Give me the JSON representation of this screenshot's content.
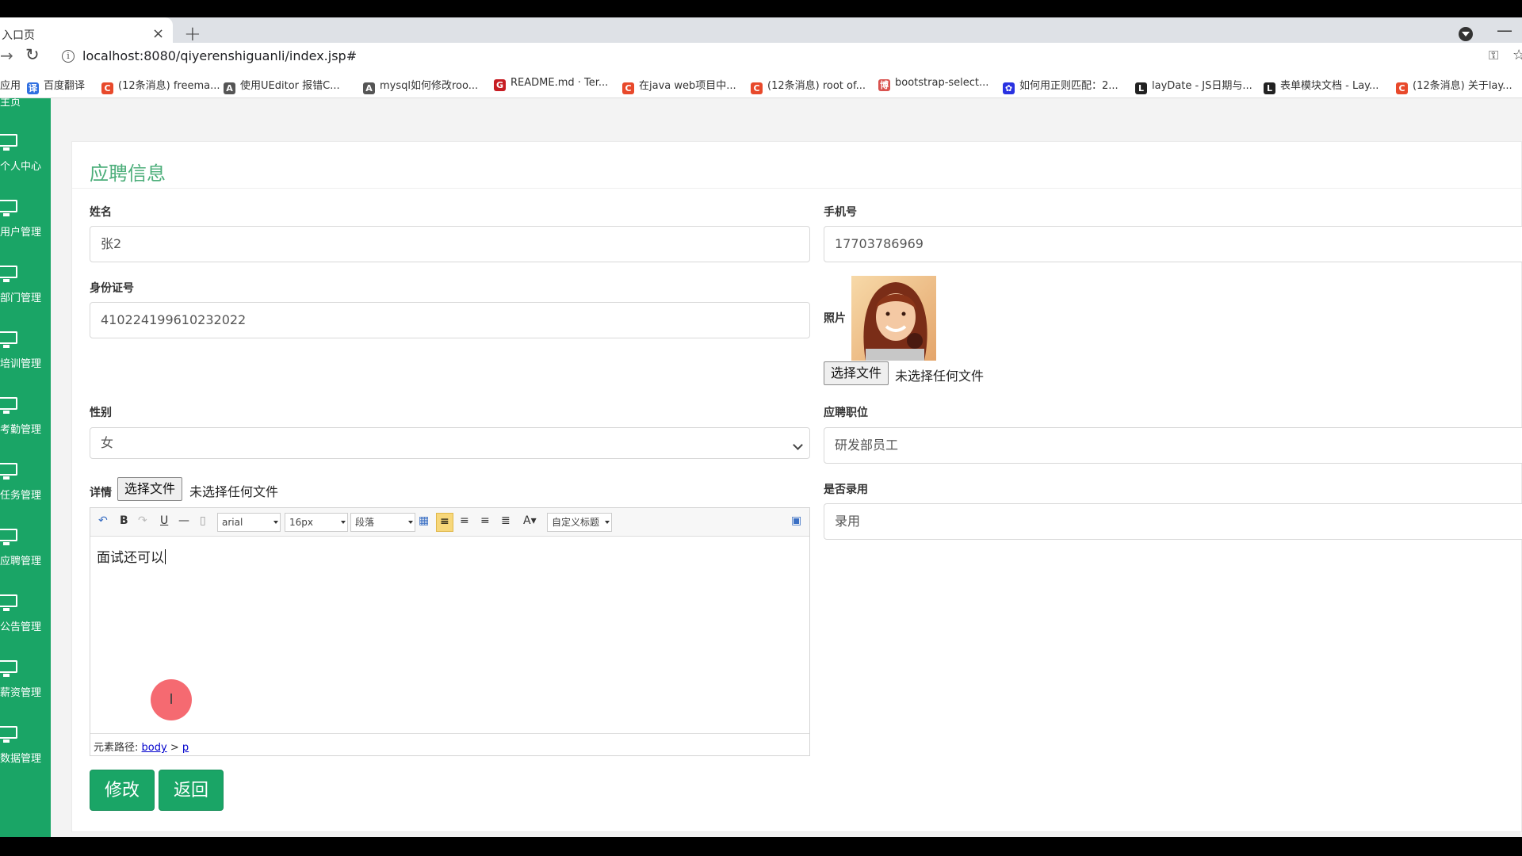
{
  "browser": {
    "tab_title": "入口页",
    "tab_close": "×",
    "new_tab": "+",
    "url": "localhost:8080/qiyerenshiguanli/index.jsp#",
    "bookmarks": [
      {
        "icon": "apps",
        "label": "应用",
        "color": "#4285f4"
      },
      {
        "icon": "translate",
        "label": "百度翻译",
        "color": "#2f6fe0",
        "glyph": "译"
      },
      {
        "icon": "csdn",
        "label": "(12条消息) freema...",
        "color": "#e8492b",
        "glyph": "C"
      },
      {
        "icon": "editor",
        "label": "使用UEditor 报错C...",
        "color": "#555",
        "glyph": "A"
      },
      {
        "icon": "editor",
        "label": "mysql如何修改roo...",
        "color": "#555",
        "glyph": "A"
      },
      {
        "icon": "gitee",
        "label": "README.md · Ter...",
        "color": "#c71d23",
        "glyph": "G"
      },
      {
        "icon": "csdn",
        "label": "在java web项目中...",
        "color": "#e8492b",
        "glyph": "C"
      },
      {
        "icon": "csdn",
        "label": "(12条消息) root of...",
        "color": "#e8492b",
        "glyph": "C"
      },
      {
        "icon": "cnblogs",
        "label": "bootstrap-select...",
        "color": "#d9534f",
        "glyph": "博"
      },
      {
        "icon": "baidu",
        "label": "如何用正则匹配：2...",
        "color": "#2932e1",
        "glyph": "✿"
      },
      {
        "icon": "layui",
        "label": "layDate - JS日期与...",
        "color": "#222",
        "glyph": "L"
      },
      {
        "icon": "layui",
        "label": "表单模块文档 - Lay...",
        "color": "#222",
        "glyph": "L"
      },
      {
        "icon": "csdn",
        "label": "(12条消息) 关于lay...",
        "color": "#e8492b",
        "glyph": "C"
      }
    ]
  },
  "sidebar": {
    "top_label": "主页",
    "items": [
      {
        "label": "个人中心"
      },
      {
        "label": "用户管理"
      },
      {
        "label": "部门管理"
      },
      {
        "label": "培训管理"
      },
      {
        "label": "考勤管理"
      },
      {
        "label": "任务管理"
      },
      {
        "label": "应聘管理"
      },
      {
        "label": "公告管理"
      },
      {
        "label": "薪资管理"
      },
      {
        "label": "数据管理"
      }
    ]
  },
  "form": {
    "title": "应聘信息",
    "name_label": "姓名",
    "name_value": "张2",
    "phone_label": "手机号",
    "phone_value": "17703786969",
    "idcard_label": "身份证号",
    "idcard_value": "410224199610232022",
    "photo_label": "照片",
    "file_button": "选择文件",
    "file_none": "未选择任何文件",
    "gender_label": "性别",
    "gender_value": "女",
    "position_label": "应聘职位",
    "position_value": "研发部员工",
    "detail_label": "详情",
    "hired_label": "是否录用",
    "hired_value": "录用",
    "submit_button": "修改",
    "back_button": "返回"
  },
  "editor": {
    "font_family": "arial",
    "font_size": "16px",
    "paragraph": "段落",
    "custom_title": "自定义标题",
    "content": "面试还可以",
    "path_label": "元素路径:",
    "path_body": "body",
    "path_sep": ">",
    "path_p": "p"
  },
  "colors": {
    "accent": "#1aa566",
    "title": "#4cae7a"
  }
}
